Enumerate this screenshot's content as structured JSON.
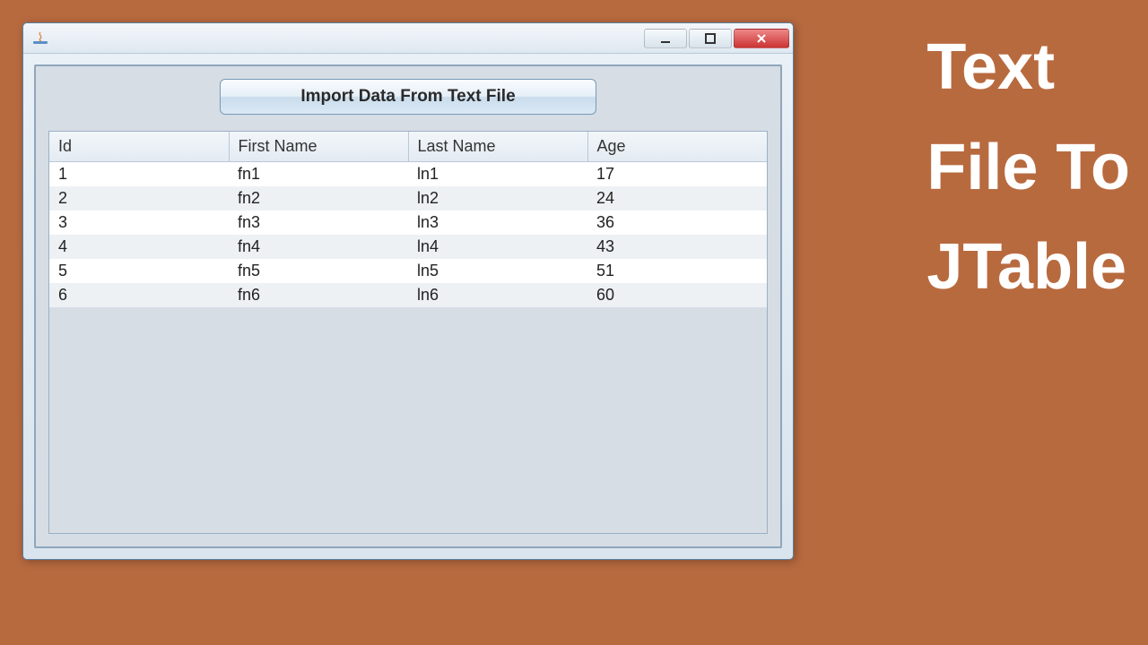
{
  "side_text": {
    "line1": "Text",
    "line2": "File To",
    "line3": "JTable"
  },
  "window": {
    "import_button_label": "Import Data From Text File"
  },
  "table": {
    "columns": [
      "Id",
      "First Name",
      "Last Name",
      "Age"
    ],
    "rows": [
      {
        "id": "1",
        "first_name": "fn1",
        "last_name": "ln1",
        "age": "17"
      },
      {
        "id": "2",
        "first_name": "fn2",
        "last_name": "ln2",
        "age": "24"
      },
      {
        "id": "3",
        "first_name": "fn3",
        "last_name": "ln3",
        "age": "36"
      },
      {
        "id": "4",
        "first_name": "fn4",
        "last_name": "ln4",
        "age": "43"
      },
      {
        "id": "5",
        "first_name": "fn5",
        "last_name": "ln5",
        "age": "51"
      },
      {
        "id": "6",
        "first_name": "fn6",
        "last_name": "ln6",
        "age": "60"
      }
    ]
  }
}
